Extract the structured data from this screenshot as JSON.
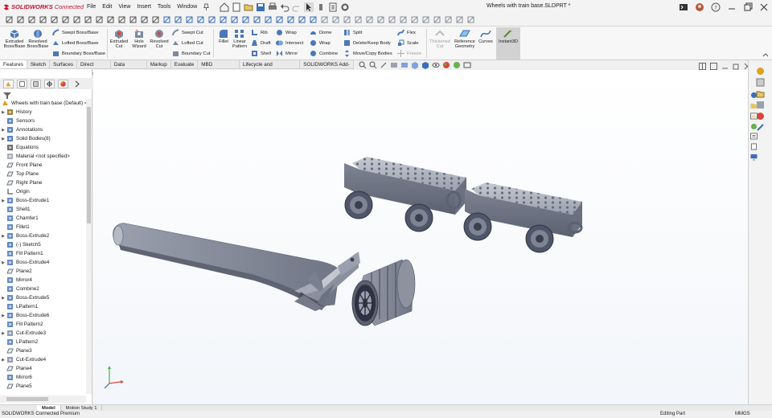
{
  "app": {
    "brand": "SOLIDWORKS",
    "brand_suffix": "Connected",
    "doc_title": "Wheels with train base.SLDPRT *",
    "menus": [
      "File",
      "Edit",
      "View",
      "Insert",
      "Tools",
      "Window"
    ]
  },
  "commands": {
    "extruded_boss": "Extruded Boss/Base",
    "revolved_boss": "Revolved Boss/Base",
    "swept_boss": "Swept Boss/Base",
    "lofted_boss": "Lofted Boss/Base",
    "boundary_boss": "Boundary Boss/Base",
    "extruded_cut": "Extruded Cut",
    "hole_wizard": "Hole Wizard",
    "revolved_cut": "Revolved Cut",
    "swept_cut": "Swept Cut",
    "lofted_cut": "Lofted Cut",
    "boundary_cut": "Boundary Cut",
    "fillet": "Fillet",
    "linear_pattern": "Linear Pattern",
    "rib": "Rib",
    "draft": "Draft",
    "shell": "Shell",
    "wrap": "Wrap",
    "intersect": "Intersect",
    "mirror": "Mirror",
    "dome": "Dome",
    "wrap2": "Wrap",
    "combine": "Combine",
    "split": "Split",
    "delete_keep": "Delete/Keep Body",
    "move_copy": "Move/Copy Bodies",
    "flex": "Flex",
    "scale": "Scale",
    "freeze": "Freeze",
    "thicken_cut": "Thickened Cut",
    "ref_geometry": "Reference Geometry",
    "curves": "Curves",
    "instant3d": "Instant3D"
  },
  "tabs": [
    "Features",
    "Sketch",
    "Surfaces",
    "Direct Editing",
    "Data Migration",
    "Markup",
    "Evaluate",
    "MBD Dimensions",
    "Lifecycle and Collaboration",
    "SOLIDWORKS Add-Ins"
  ],
  "tree": {
    "root": "Wheels with train base (Default) <<",
    "items": [
      {
        "label": "History",
        "icon": "history",
        "exp": true
      },
      {
        "label": "Sensors",
        "icon": "sensor",
        "exp": false
      },
      {
        "label": "Annotations",
        "icon": "annotation",
        "exp": true
      },
      {
        "label": "Solid Bodies(8)",
        "icon": "solid-bodies",
        "exp": true
      },
      {
        "label": "Equations",
        "icon": "equation",
        "exp": false
      },
      {
        "label": "Material <not specified>",
        "icon": "material",
        "exp": false
      },
      {
        "label": "Front Plane",
        "icon": "plane",
        "exp": false
      },
      {
        "label": "Top Plane",
        "icon": "plane",
        "exp": false
      },
      {
        "label": "Right Plane",
        "icon": "plane",
        "exp": false
      },
      {
        "label": "Origin",
        "icon": "origin",
        "exp": false
      },
      {
        "label": "Boss-Extrude1",
        "icon": "extrude",
        "exp": true
      },
      {
        "label": "Shell1",
        "icon": "shell",
        "exp": false
      },
      {
        "label": "Chamfer1",
        "icon": "chamfer",
        "exp": false
      },
      {
        "label": "Fillet1",
        "icon": "fillet",
        "exp": false
      },
      {
        "label": "Boss-Extrude2",
        "icon": "extrude",
        "exp": true
      },
      {
        "label": "(-) Sketch5",
        "icon": "sketch",
        "exp": false
      },
      {
        "label": "Fill Pattern1",
        "icon": "pattern",
        "exp": false
      },
      {
        "label": "Boss-Extrude4",
        "icon": "extrude",
        "exp": true
      },
      {
        "label": "Plane2",
        "icon": "plane",
        "exp": false
      },
      {
        "label": "Mirror4",
        "icon": "mirror",
        "exp": false
      },
      {
        "label": "Combine2",
        "icon": "combine",
        "exp": false
      },
      {
        "label": "Boss-Extrude5",
        "icon": "extrude",
        "exp": true
      },
      {
        "label": "LPattern1",
        "icon": "pattern",
        "exp": false
      },
      {
        "label": "Boss-Extrude6",
        "icon": "extrude",
        "exp": true
      },
      {
        "label": "Fill Pattern2",
        "icon": "pattern",
        "exp": false
      },
      {
        "label": "Cut-Extrude3",
        "icon": "cut",
        "exp": true
      },
      {
        "label": "LPattern2",
        "icon": "pattern",
        "exp": false
      },
      {
        "label": "Plane3",
        "icon": "plane",
        "exp": false
      },
      {
        "label": "Cut-Extrude4",
        "icon": "cut",
        "exp": true
      },
      {
        "label": "Plane4",
        "icon": "plane",
        "exp": false
      },
      {
        "label": "Mirror6",
        "icon": "mirror",
        "exp": false
      },
      {
        "label": "Plane5",
        "icon": "plane",
        "exp": false
      }
    ]
  },
  "bottom_tabs": [
    "Model",
    "Motion Study 1"
  ],
  "status": {
    "left": "SOLIDWORKS Connected Premium",
    "mode": "Editing Part",
    "units": "MMGS"
  },
  "colors": {
    "accent": "#c8102e",
    "part": "#9aa0ad",
    "bg": "#f0f0f0"
  }
}
